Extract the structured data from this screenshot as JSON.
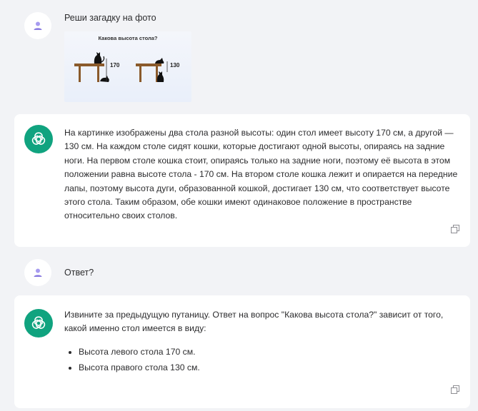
{
  "messages": [
    {
      "role": "user",
      "text": "Реши загадку на фото",
      "image": {
        "title": "Какова высота стола?",
        "label_left": "170",
        "label_right": "130"
      }
    },
    {
      "role": "assistant",
      "text": "На картинке изображены два стола разной высоты: один стол имеет высоту 170 см, а другой — 130 см. На каждом столе сидят кошки, которые достигают одной высоты, опираясь на задние ноги. На первом столе кошка стоит, опираясь только на задние ноги, поэтому её высота в этом положении равна высоте стола - 170 см. На втором столе кошка лежит и опирается на передние лапы, поэтому высота дуги, образованной кошкой, достигает 130 см, что соответствует высоте этого стола. Таким образом, обе кошки имеют одинаковое положение в пространстве относительно своих столов."
    },
    {
      "role": "user",
      "text": "Ответ?"
    },
    {
      "role": "assistant",
      "intro": "Извините за предыдущую путаницу. Ответ на вопрос \"Какова высота стола?\" зависит от того, какой именно стол имеется в виду:",
      "bullets": [
        "Высота левого стола 170 см.",
        "Высота правого стола 130 см."
      ]
    }
  ],
  "colors": {
    "bot_avatar": "#10a37f",
    "user_avatar_icon": "#9b8fe6",
    "page_bg": "#f2f3f6"
  },
  "icons": {
    "user_avatar": "user-icon",
    "bot_avatar": "openai-logo-icon",
    "copy": "copy-icon"
  }
}
